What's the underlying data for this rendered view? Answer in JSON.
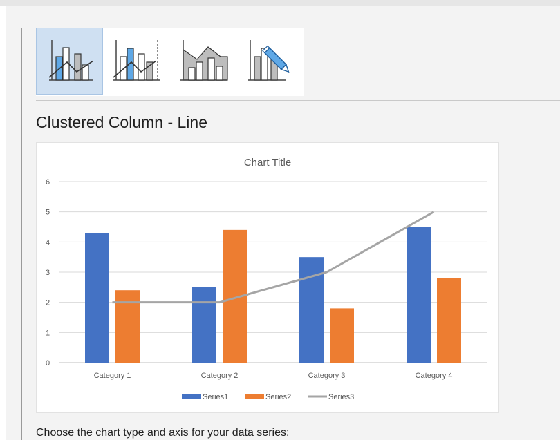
{
  "gallery": {
    "items": [
      {
        "icon": "clustered-column-line-icon",
        "selected": true
      },
      {
        "icon": "clustered-column-line-secondary-axis-icon",
        "selected": false
      },
      {
        "icon": "stacked-area-clustered-column-icon",
        "selected": false
      },
      {
        "icon": "custom-combination-icon",
        "selected": false
      }
    ]
  },
  "section_title": "Clustered Column - Line",
  "chart_data": {
    "type": "bar",
    "title": "Chart Title",
    "categories": [
      "Category 1",
      "Category 2",
      "Category 3",
      "Category 4"
    ],
    "series": [
      {
        "name": "Series1",
        "type": "bar",
        "values": [
          4.3,
          2.5,
          3.5,
          4.5
        ],
        "color": "#4472c4"
      },
      {
        "name": "Series2",
        "type": "bar",
        "values": [
          2.4,
          4.4,
          1.8,
          2.8
        ],
        "color": "#ed7d31"
      },
      {
        "name": "Series3",
        "type": "line",
        "values": [
          2,
          2,
          3,
          5
        ],
        "color": "#a5a5a5"
      }
    ],
    "ylim": [
      0,
      6
    ],
    "yticks": [
      "0",
      "1",
      "2",
      "3",
      "4",
      "5",
      "6"
    ],
    "grid": true,
    "legend": "bottom"
  },
  "footer_label": "Choose the chart type and axis for your data series:"
}
